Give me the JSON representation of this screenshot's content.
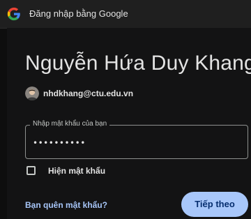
{
  "header": {
    "logo_icon": "google-g-icon",
    "title": "Đăng nhập bằng Google"
  },
  "account": {
    "name": "Nguyễn Hứa Duy Khang",
    "email": "nhdkhang@ctu.edu.vn",
    "avatar_icon": "user-avatar"
  },
  "password": {
    "label": "Nhập mật khẩu của bạn",
    "value": "••••••••••"
  },
  "show_password": {
    "label": "Hiện mật khẩu",
    "checked": false
  },
  "actions": {
    "forgot_label": "Bạn quên mật khẩu?",
    "next_label": "Tiếp theo"
  },
  "colors": {
    "background": "#131314",
    "header_bg": "#1f1f1f",
    "text": "#e3e3e3",
    "accent": "#a8c7fa",
    "button_text": "#062e6f"
  }
}
